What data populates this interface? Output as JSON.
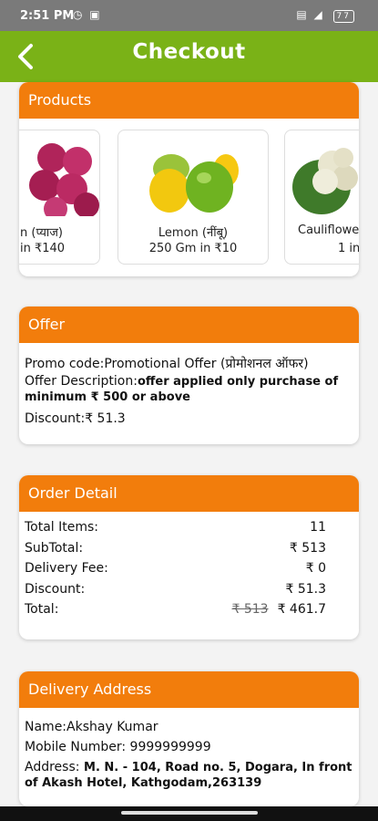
{
  "status": {
    "time": "2:51 PM",
    "battery": "77"
  },
  "appbar": {
    "title": "Checkout"
  },
  "products": {
    "heading": "Products",
    "items": [
      {
        "name": "n (प्याज)",
        "qty": "in ₹140"
      },
      {
        "name": "Lemon (नींबू)",
        "qty": "250 Gm in ₹10"
      },
      {
        "name": "Cauliflowe",
        "qty": "1 in"
      }
    ]
  },
  "offer": {
    "heading": "Offer",
    "promo_label": "Promo code:",
    "promo_value": "Promotional Offer (प्रोमोशनल ऑफर)",
    "desc_label": "Offer Description:",
    "desc_value": "offer applied only purchase of minimum ₹ 500 or above",
    "discount_label": "Discount:",
    "discount_value": "₹ 51.3"
  },
  "order": {
    "heading": "Order Detail",
    "rows": [
      {
        "label": "Total Items:",
        "value": "11"
      },
      {
        "label": "SubTotal:",
        "value": "₹ 513"
      },
      {
        "label": "Delivery Fee:",
        "value": "₹ 0"
      },
      {
        "label": "Discount:",
        "value": "₹ 51.3"
      }
    ],
    "total_label": "Total:",
    "total_original": "₹ 513",
    "total_value": "₹ 461.7"
  },
  "address": {
    "heading": "Delivery Address",
    "name_label": "Name:",
    "name_value": "Akshay Kumar",
    "mobile_label": "Mobile Number: ",
    "mobile_value": "9999999999",
    "address_label": "Address:",
    "address_value": " M. N. - 104, Road no. 5, Dogara, In front of Akash Hotel, Kathgodam,263139"
  },
  "colors": {
    "green": "#7ab217",
    "orange": "#f27d0c"
  }
}
